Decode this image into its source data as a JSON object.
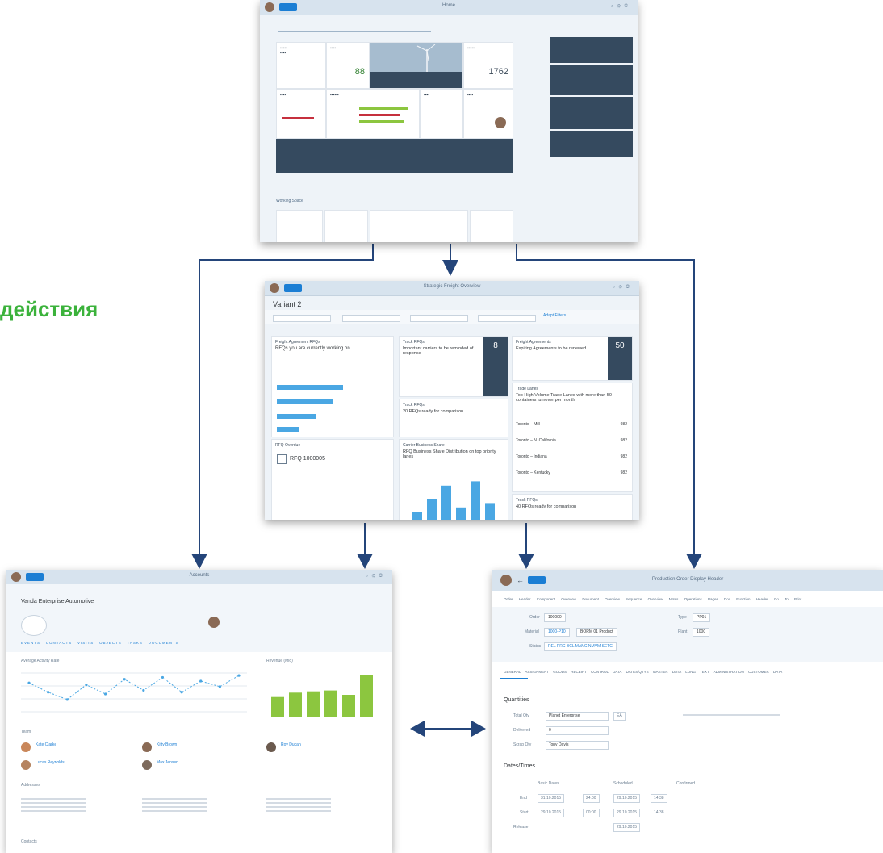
{
  "label": "действия",
  "screens": {
    "launchpad": {
      "shell_title": "Home",
      "section": "Working Space"
    },
    "overview": {
      "shell_title": "Strategic Freight Overview",
      "variant": "Variant 2",
      "filter_link": "Adapt Filters",
      "cards": {
        "agreements": "Freight Agreement RFQs",
        "agreements_sub": "RFQs you are currently working on",
        "rfqs": "Track RFQs",
        "rfqs_sub": "Important carriers to be reminded of response",
        "rfqs_value": "8",
        "expiring": "Freight Agreements",
        "expiring_sub": "Expiring Agreements to be renewed",
        "expiring_value": "50",
        "ready": "Track RFQs",
        "ready_sub": "20 RFQs ready for comparison",
        "lanes": "Trade Lanes",
        "lanes_sub": "Top High Volume Trade Lanes with more than 50 containers turnover per month",
        "share": "Carrier Business Share",
        "share_sub": "RFQ Business Share Distribution on top priority lanes",
        "rfq_status": "RFQ Overdue",
        "rfq_item": "RFQ 1000005",
        "ready2": "Track RFQs",
        "ready2_sub": "40 RFQs ready for comparison"
      },
      "lane_rows": [
        "Toronto – Mill",
        "Toronto – N. California",
        "Toronto – Indiana",
        "Toronto – Kentucky"
      ],
      "lane_values": [
        "982",
        "982",
        "982",
        "982"
      ]
    },
    "account": {
      "shell_title": "Accounts",
      "object_title": "Vanda Enterprise Automotive",
      "tabs": [
        "EVENTS",
        "CONTACTS",
        "VISITS",
        "OBJECTS",
        "TASKS",
        "DOCUMENTS"
      ],
      "chart_left": "Average Activity Rate",
      "chart_right": "Revenue (Mio)",
      "contacts_title": "Team",
      "people": [
        "Kate Clarke",
        "Kitty Brown",
        "Roy Ducan",
        "Lucas Reynolds",
        "Max Jensen"
      ],
      "addresses_title": "Addresses",
      "footer_label": "Contacts"
    },
    "order": {
      "shell_title": "Production Order Display Header",
      "menu": [
        "Order Header",
        "Component Overview",
        "Document Overview",
        "Sequence Overview",
        "Notes",
        "Operations",
        "Pages",
        "Doc",
        "Function",
        "Header",
        "Go To",
        "Print"
      ],
      "fields": {
        "order_label": "Order",
        "order_value": "100000",
        "material_label": "Material",
        "material_value": "1000-P10",
        "material_desc": "BORM 01 Product",
        "status_label": "Status",
        "status_value": "REL PRC BCL MANC NMVM SETC",
        "type_label": "Type",
        "type_value": "PP01",
        "plant_label": "Plant",
        "plant_value": "1000"
      },
      "tabs": [
        "GENERAL",
        "ASSIGNMENT",
        "GOODS RECEIPT",
        "CONTROL DATA",
        "DATES/QTYS",
        "MASTER DATA",
        "LONG TEXT",
        "ADMINISTRATION",
        "CUSTOMER DATA"
      ],
      "quantities_title": "Quantities",
      "qty_rows": [
        {
          "label": "Total Qty",
          "value": "Planet Enterprise",
          "unit": "EA"
        },
        {
          "label": "Delivered",
          "value": "0",
          "unit": ""
        },
        {
          "label": "Scrap Qty",
          "value": "Tony Davis",
          "unit": ""
        }
      ],
      "dates_title": "Dates/Times",
      "date_cols": [
        "Basic Dates",
        "Scheduled",
        "Confirmed"
      ],
      "date_rows": [
        {
          "label": "End",
          "d1": "31.10.2015",
          "t1": "24:00",
          "d2": "29.10.2015",
          "t2": "14:38"
        },
        {
          "label": "Start",
          "d1": "29.10.2015",
          "t1": "00:00",
          "d2": "29.10.2015",
          "t2": "14:38"
        },
        {
          "label": "Release",
          "d1": "",
          "t1": "",
          "d2": "29.10.2015",
          "t2": ""
        }
      ]
    }
  },
  "colors": {
    "arrow": "#24457a",
    "label": "#3bb23b",
    "tile_dark": "#354a5f",
    "bar_blue": "#4aa7e3",
    "bar_green": "#8cc63f"
  },
  "chart_data": [
    {
      "type": "bar",
      "categories": [
        "1",
        "2",
        "3",
        "4",
        "5",
        "6"
      ],
      "values": [
        2,
        5,
        8,
        3,
        9,
        4
      ],
      "title": "",
      "xlabel": "",
      "ylabel": ""
    },
    {
      "type": "bar",
      "categories": [
        "1",
        "2",
        "3",
        "4",
        "5",
        "6"
      ],
      "values": [
        45,
        55,
        58,
        60,
        50,
        95
      ],
      "title": "Revenue (Mio)",
      "xlabel": "",
      "ylabel": ""
    }
  ]
}
